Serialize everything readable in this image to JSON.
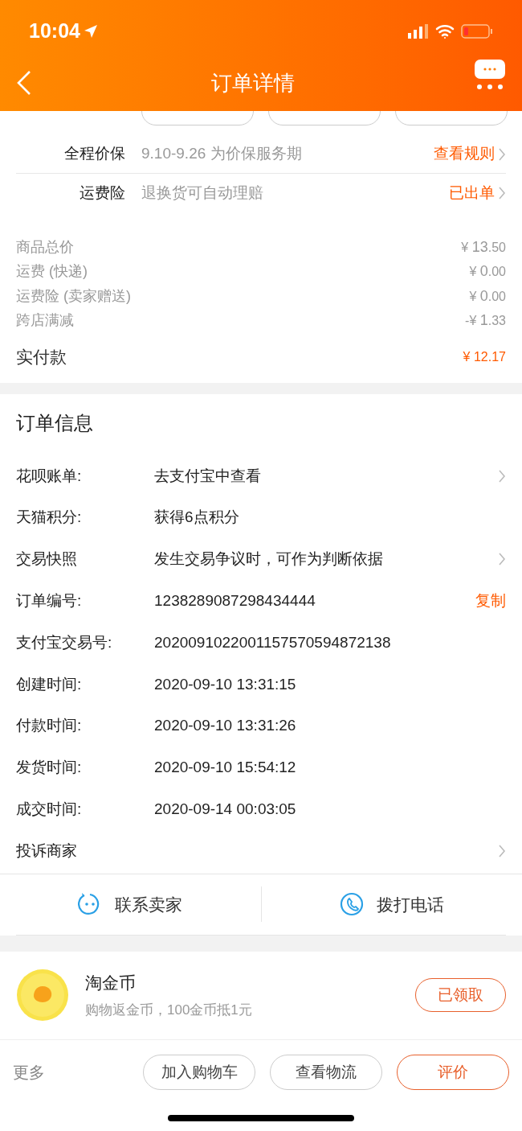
{
  "status_bar": {
    "time": "10:04"
  },
  "nav": {
    "title": "订单详情"
  },
  "services": [
    {
      "label": "全程价保",
      "text": "9.10-9.26 为价保服务期",
      "action": "查看规则"
    },
    {
      "label": "运费险",
      "text": "退换货可自动理赔",
      "action": "已出单"
    }
  ],
  "prices": [
    {
      "label": "商品总价",
      "prefix": "¥",
      "main": "13",
      "fraction": ".50"
    },
    {
      "label": "运费 (快递)",
      "prefix": "¥",
      "main": "0",
      "fraction": ".00"
    },
    {
      "label": "运费险 (卖家赠送)",
      "prefix": "¥",
      "main": "0",
      "fraction": ".00"
    },
    {
      "label": "跨店满减",
      "prefix": "-¥",
      "main": "1",
      "fraction": ".33"
    }
  ],
  "total": {
    "label": "实付款",
    "prefix": "¥",
    "main": "12",
    "fraction": ".17"
  },
  "order_info": {
    "title": "订单信息",
    "rows": [
      {
        "label": "花呗账单:",
        "value": "去支付宝中查看",
        "chevron": true
      },
      {
        "label": "天猫积分:",
        "value": "获得6点积分",
        "chevron": false
      },
      {
        "label": "交易快照",
        "value": "发生交易争议时，可作为判断依据",
        "chevron": true
      },
      {
        "label": "订单编号:",
        "value": "1238289087298434444",
        "action": "复制",
        "chevron": false
      },
      {
        "label": "支付宝交易号:",
        "value": "2020091022001157570594872138",
        "chevron": false
      },
      {
        "label": "创建时间:",
        "value": "2020-09-10 13:31:15",
        "chevron": false
      },
      {
        "label": "付款时间:",
        "value": "2020-09-10 13:31:26",
        "chevron": false
      },
      {
        "label": "发货时间:",
        "value": "2020-09-10 15:54:12",
        "chevron": false
      },
      {
        "label": "成交时间:",
        "value": "2020-09-14 00:03:05",
        "chevron": false
      },
      {
        "label": "投诉商家",
        "chevron": true
      }
    ]
  },
  "contact": [
    {
      "kind": "chat",
      "label": "联系卖家"
    },
    {
      "kind": "phone",
      "label": "拨打电话"
    }
  ],
  "coins": {
    "title": "淘金币",
    "subtitle": "购物返金币，100金币抵1元",
    "button": "已领取"
  },
  "bottom_bar": {
    "more": "更多",
    "buttons": [
      {
        "label": "加入购物车",
        "primary": false
      },
      {
        "label": "查看物流",
        "primary": false
      },
      {
        "label": "评价",
        "primary": true
      }
    ]
  }
}
